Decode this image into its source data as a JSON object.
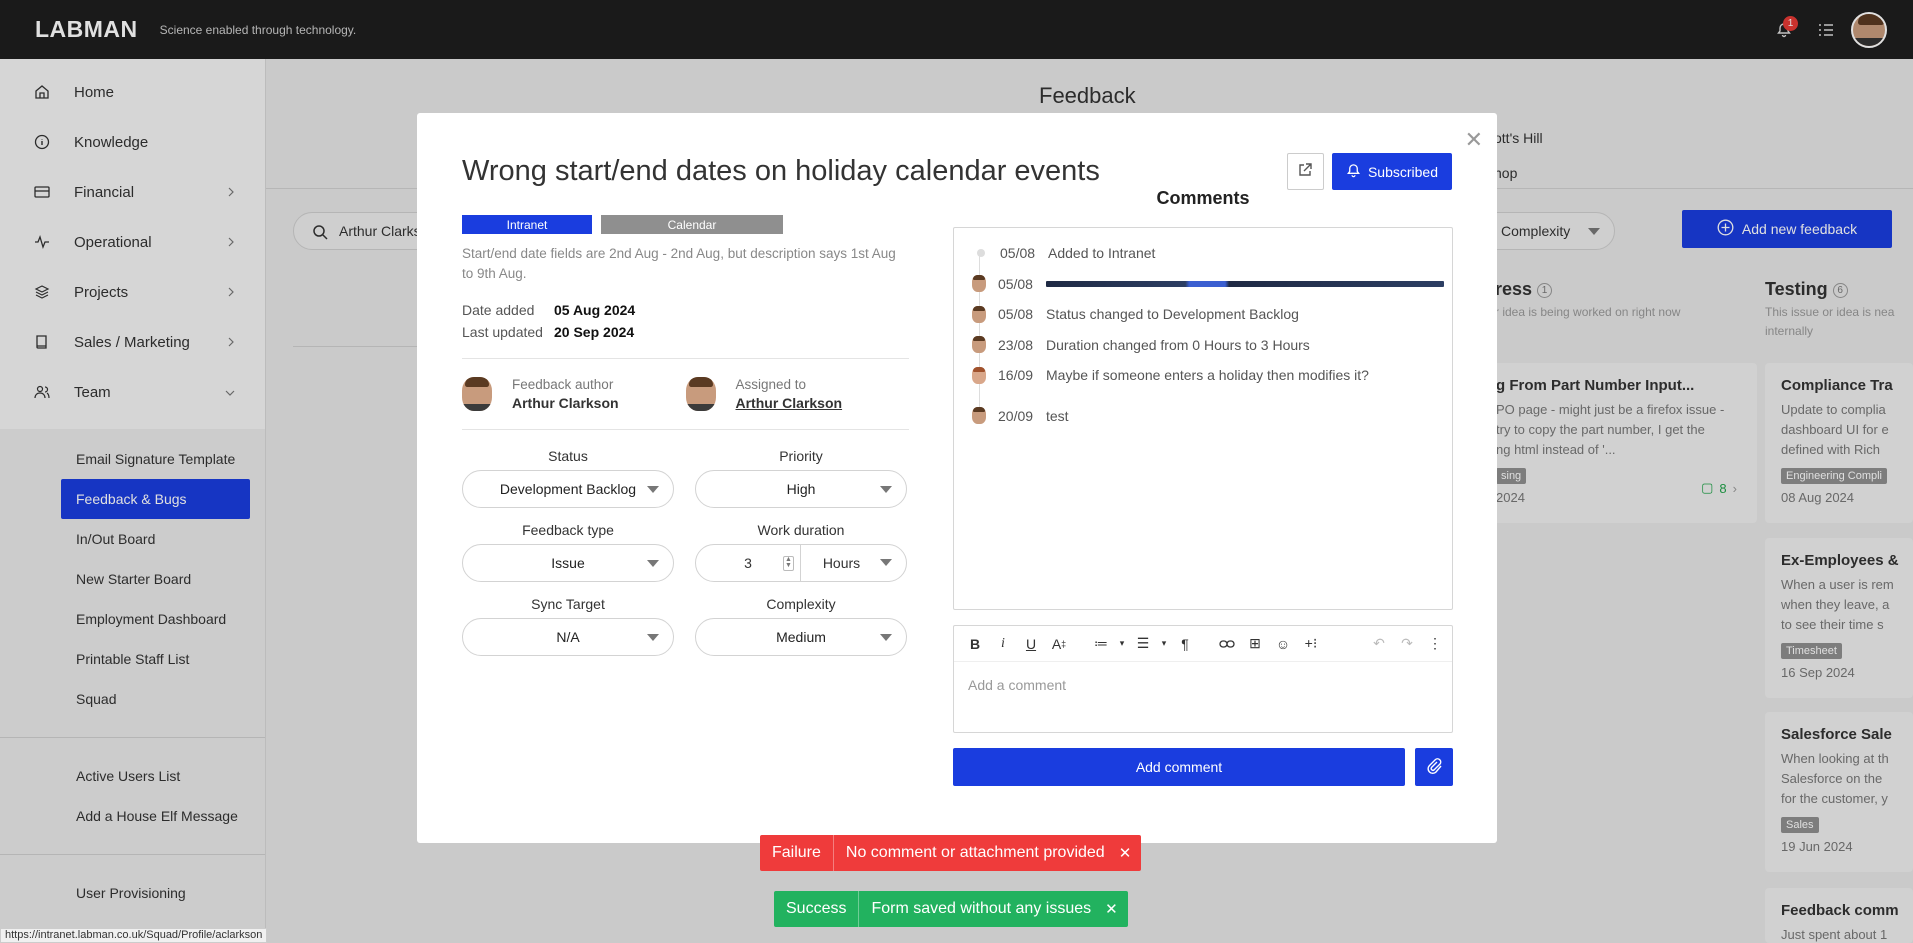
{
  "app": {
    "logo": "LABMAN",
    "tagline": "Science enabled through technology."
  },
  "topbar": {
    "notification_count": "1"
  },
  "sidebar": {
    "items": [
      {
        "label": "Home",
        "icon": "home-icon"
      },
      {
        "label": "Knowledge",
        "icon": "info-icon"
      },
      {
        "label": "Financial",
        "icon": "card-icon"
      },
      {
        "label": "Operational",
        "icon": "pulse-icon"
      },
      {
        "label": "Projects",
        "icon": "layers-icon"
      },
      {
        "label": "Sales / Marketing",
        "icon": "book-icon"
      },
      {
        "label": "Team",
        "icon": "users-icon"
      }
    ],
    "team_subitems": [
      "Email Signature Template",
      "Feedback & Bugs",
      "In/Out Board",
      "New Starter Board",
      "Employment Dashboard",
      "Printable Staff List",
      "Squad"
    ],
    "extra_items": [
      "Active Users List",
      "Add a House Elf Message"
    ],
    "bottom_items": [
      "User Provisioning"
    ]
  },
  "page": {
    "title": "Feedback",
    "links": [
      "ott's Hill",
      "hop"
    ],
    "search_value": "Arthur Clarks",
    "complexity_filter": "Complexity",
    "add_button": "Add new feedback",
    "columns": [
      {
        "title": "ress",
        "count": "1",
        "sub": "r idea is being worked on right now"
      },
      {
        "title": "Testing",
        "count": "6",
        "sub1": "This issue or idea is nea",
        "sub2": "internally"
      }
    ],
    "cards": [
      {
        "title": "g From Part Number Input...",
        "desc1": "PO page - might just be a firefox issue -",
        "desc2": "try to copy the part number, I get the",
        "desc3": "ng html instead of '...",
        "tag": "sing",
        "date": "2024",
        "comments": "8"
      },
      {
        "title": "Compliance Tra",
        "desc1": "Update to complia",
        "desc2": "dashboard UI for e",
        "desc3": "defined with Rich",
        "tag": "Engineering Compli",
        "date": "08 Aug 2024"
      },
      {
        "title": "Ex-Employees &",
        "desc1": "When a user is rem",
        "desc2": "when they leave, a",
        "desc3": "to see their time s",
        "tag": "Timesheet",
        "date": "16 Sep 2024"
      },
      {
        "title": "Salesforce Sale",
        "desc1": "When looking at th",
        "desc2": "Salesforce on the",
        "desc3": "for the customer, y",
        "tag": "Sales",
        "date": "19 Jun 2024"
      },
      {
        "title": "Feedback comm",
        "desc1": "Just spent about 1"
      }
    ]
  },
  "modal": {
    "title": "Wrong start/end dates on holiday calendar events",
    "subscribed_label": "Subscribed",
    "tags": [
      "Intranet",
      "Calendar"
    ],
    "description": "Start/end date fields are 2nd Aug - 2nd Aug, but description says 1st Aug to 9th Aug.",
    "date_added_label": "Date added",
    "date_added": "05 Aug 2024",
    "last_updated_label": "Last updated",
    "last_updated": "20 Sep 2024",
    "author_label": "Feedback author",
    "author": "Arthur Clarkson",
    "assigned_label": "Assigned to",
    "assigned": "Arthur Clarkson",
    "fields": {
      "status_label": "Status",
      "status": "Development Backlog",
      "priority_label": "Priority",
      "priority": "High",
      "type_label": "Feedback type",
      "type": "Issue",
      "duration_label": "Work duration",
      "duration_value": "3",
      "duration_unit": "Hours",
      "sync_label": "Sync Target",
      "sync": "N/A",
      "complexity_label": "Complexity",
      "complexity": "Medium"
    },
    "comments_title": "Comments",
    "comments": [
      {
        "date": "05/08",
        "text": "Added to Intranet"
      },
      {
        "date": "05/08",
        "text": ""
      },
      {
        "date": "05/08",
        "text": "Status changed to Development Backlog"
      },
      {
        "date": "23/08",
        "text": "Duration changed from 0 Hours to 3 Hours"
      },
      {
        "date": "16/09",
        "text": "Maybe if someone enters a holiday then modifies it?"
      },
      {
        "date": "20/09",
        "text": "test"
      }
    ],
    "comment_placeholder": "Add a comment",
    "add_comment_label": "Add comment"
  },
  "toasts": {
    "failure": {
      "label": "Failure",
      "message": "No comment or attachment provided"
    },
    "success": {
      "label": "Success",
      "message": "Form saved without any issues"
    }
  },
  "statusbar": {
    "url": "https://intranet.labman.co.uk/Squad/Profile/aclarkson"
  },
  "colors": {
    "accent": "#1a3ddf",
    "failure": "#ef3b3b",
    "success": "#22b25f",
    "topbar": "#1e1e1e"
  }
}
